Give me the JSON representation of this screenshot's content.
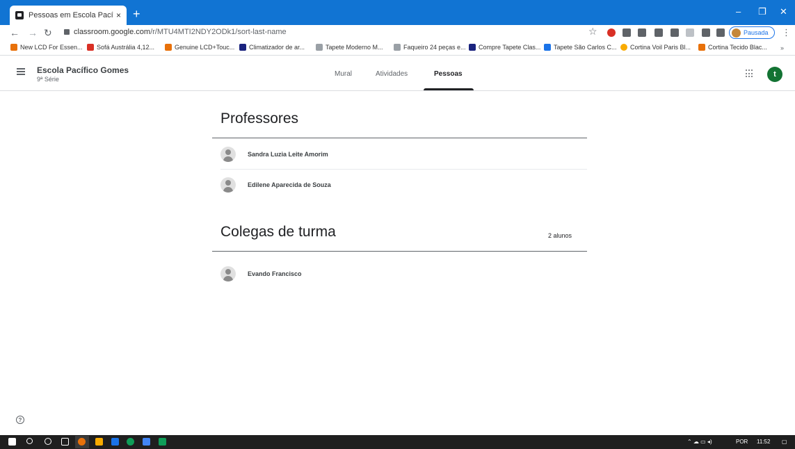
{
  "browser": {
    "tab_title": "Pessoas em Escola Pacífico Gome",
    "tab_close": "×",
    "new_tab": "+",
    "url_host": "classroom.google.com",
    "url_path": "/r/MTU4MTI2NDY2ODk1/sort-last-name",
    "profile_label": "Pausada",
    "bookmarks": [
      {
        "label": "New LCD For Essen...",
        "color": "#e8710a"
      },
      {
        "label": "Sofá Austrália 4,12...",
        "color": "#d93025"
      },
      {
        "label": "Genuine LCD+Touc...",
        "color": "#e8710a"
      },
      {
        "label": "Climatizador de ar...",
        "color": "#1a237e"
      },
      {
        "label": "Tapete Moderno M...",
        "color": "#5f6368"
      },
      {
        "label": "Faqueiro 24 peças e...",
        "color": "#5f6368"
      },
      {
        "label": "Compre Tapete Clas...",
        "color": "#1a237e"
      },
      {
        "label": "Tapete São Carlos C...",
        "color": "#1a73e8"
      },
      {
        "label": "Cortina Voil Paris Bl...",
        "color": "#f9ab00"
      },
      {
        "label": "Cortina Tecido Blac...",
        "color": "#e8710a"
      }
    ],
    "bookmarks_more": "»"
  },
  "classroom": {
    "class_name": "Escola Pacífico Gomes",
    "class_section": "9ª Série",
    "tabs": [
      "Mural",
      "Atividades",
      "Pessoas"
    ],
    "user_initial": "t",
    "accent": "#137333"
  },
  "teachers": {
    "title": "Professores",
    "people": [
      "Sandra Luzia Leite Amorim",
      "Edilene Aparecida de Souza"
    ]
  },
  "classmates": {
    "title": "Colegas de turma",
    "count": "2 alunos",
    "people": [
      "Evando Francisco"
    ]
  },
  "help_icon": "?",
  "taskbar": {
    "language": "POR",
    "time": "11:52"
  }
}
